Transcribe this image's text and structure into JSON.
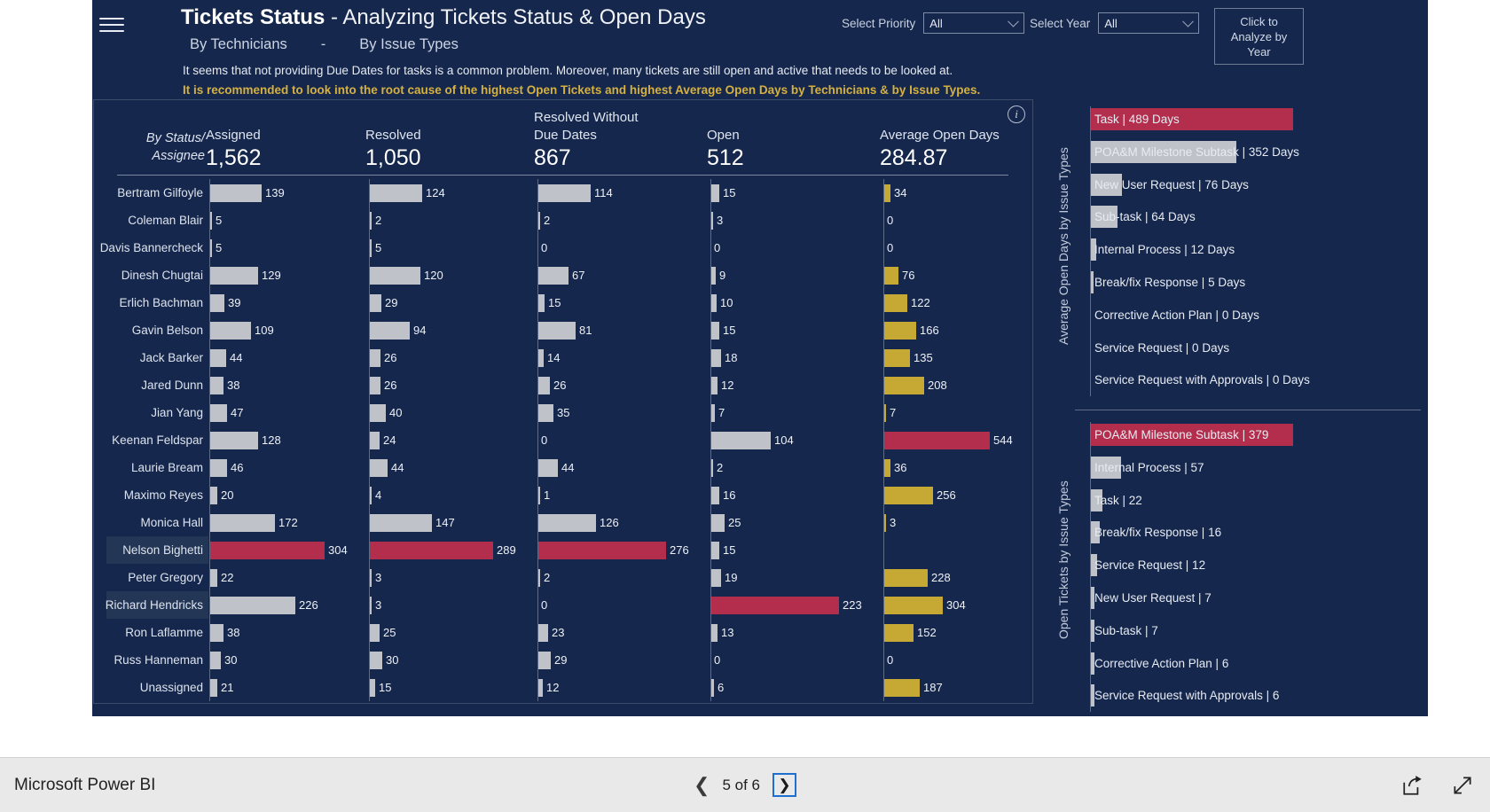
{
  "header": {
    "menu_icon": "hamburger-icon",
    "title_main": "Tickets Status",
    "title_dash": "-",
    "title_sub": "Analyzing Tickets Status & Open Days",
    "sub_left": "By Technicians",
    "sub_dash": "-",
    "sub_right": "By Issue Types",
    "narrative_line1": "It seems that not providing Due Dates for tasks is a common problem. Moreover, many tickets are still open and active that needs to be looked at.",
    "narrative_line2": "It is recommended to look into the root cause of the highest Open Tickets and highest Average Open Days by Technicians & by Issue Types.",
    "narrative_accent_color": "#d6b13f"
  },
  "slicers": [
    {
      "label": "Select Priority",
      "value": "All",
      "name": "priority-slicer"
    },
    {
      "label": "Select Year",
      "value": "All",
      "name": "year-slicer"
    }
  ],
  "analyze_button": {
    "line1": "Click to",
    "line2": "Analyze by",
    "line3": "Year"
  },
  "card": {
    "info_icon": "info-icon",
    "row_header_label_line1": "By Status/",
    "row_header_label_line2": "Assignee"
  },
  "chart_data": {
    "type": "table",
    "title": "Tickets Status by Technicians",
    "row_header": "By Status/Assignee",
    "columns": [
      {
        "label": "Assigned",
        "total": "1,562",
        "max": 304,
        "color": "#bfc3c9"
      },
      {
        "label": "Resolved",
        "total": "1,050",
        "max": 289,
        "color": "#bfc3c9"
      },
      {
        "label": "Resolved Without Due Dates",
        "total": "867",
        "max": 276,
        "color": "#bfc3c9"
      },
      {
        "label": "Open",
        "total": "512",
        "max": 223,
        "color": "#bfc3c9"
      },
      {
        "label": "Average Open Days",
        "total": "284.87",
        "max": 544,
        "color": "#c6a935"
      }
    ],
    "highlight_color": "#b32e4d",
    "selected_rows": [
      "Nelson Bighetti",
      "Richard Hendricks"
    ],
    "rows": [
      {
        "name": "Bertram Gilfoyle",
        "assigned": 139,
        "resolved": 124,
        "resolved_no_due": 114,
        "open": 15,
        "avg_open_days": 34
      },
      {
        "name": "Coleman Blair",
        "assigned": 5,
        "resolved": 2,
        "resolved_no_due": 2,
        "open": 3,
        "avg_open_days": 0
      },
      {
        "name": "Davis Bannercheck",
        "assigned": 5,
        "resolved": 5,
        "resolved_no_due": 0,
        "open": 0,
        "avg_open_days": 0
      },
      {
        "name": "Dinesh Chugtai",
        "assigned": 129,
        "resolved": 120,
        "resolved_no_due": 67,
        "open": 9,
        "avg_open_days": 76
      },
      {
        "name": "Erlich Bachman",
        "assigned": 39,
        "resolved": 29,
        "resolved_no_due": 15,
        "open": 10,
        "avg_open_days": 122
      },
      {
        "name": "Gavin Belson",
        "assigned": 109,
        "resolved": 94,
        "resolved_no_due": 81,
        "open": 15,
        "avg_open_days": 166
      },
      {
        "name": "Jack Barker",
        "assigned": 44,
        "resolved": 26,
        "resolved_no_due": 14,
        "open": 18,
        "avg_open_days": 135
      },
      {
        "name": "Jared Dunn",
        "assigned": 38,
        "resolved": 26,
        "resolved_no_due": 26,
        "open": 12,
        "avg_open_days": 208
      },
      {
        "name": "Jian Yang",
        "assigned": 47,
        "resolved": 40,
        "resolved_no_due": 35,
        "open": 7,
        "avg_open_days": 7
      },
      {
        "name": "Keenan Feldspar",
        "assigned": 128,
        "resolved": 24,
        "resolved_no_due": 0,
        "open": 104,
        "avg_open_days": 544,
        "avg_open_days_highlight": true
      },
      {
        "name": "Laurie Bream",
        "assigned": 46,
        "resolved": 44,
        "resolved_no_due": 44,
        "open": 2,
        "avg_open_days": 36
      },
      {
        "name": "Maximo Reyes",
        "assigned": 20,
        "resolved": 4,
        "resolved_no_due": 1,
        "open": 16,
        "avg_open_days": 256
      },
      {
        "name": "Monica Hall",
        "assigned": 172,
        "resolved": 147,
        "resolved_no_due": 126,
        "open": 25,
        "avg_open_days": 3
      },
      {
        "name": "Nelson Bighetti",
        "assigned": 304,
        "resolved": 289,
        "resolved_no_due": 276,
        "open": 15,
        "avg_open_days": null,
        "assigned_highlight": true,
        "resolved_highlight": true,
        "resolved_no_due_highlight": true
      },
      {
        "name": "Peter Gregory",
        "assigned": 22,
        "resolved": 3,
        "resolved_no_due": 2,
        "open": 19,
        "avg_open_days": 228
      },
      {
        "name": "Richard Hendricks",
        "assigned": 226,
        "resolved": 3,
        "resolved_no_due": 0,
        "open": 223,
        "avg_open_days": 304,
        "open_highlight": true
      },
      {
        "name": "Ron Laflamme",
        "assigned": 38,
        "resolved": 25,
        "resolved_no_due": 23,
        "open": 13,
        "avg_open_days": 152
      },
      {
        "name": "Russ Hanneman",
        "assigned": 30,
        "resolved": 30,
        "resolved_no_due": 29,
        "open": 0,
        "avg_open_days": 0
      },
      {
        "name": "Unassigned",
        "assigned": 21,
        "resolved": 15,
        "resolved_no_due": 12,
        "open": 6,
        "avg_open_days": 187
      }
    ]
  },
  "right_panels": [
    {
      "axis_title": "Average Open Days by Issue Types",
      "name": "avg-open-days-by-issue-types",
      "type": "bar",
      "max": 489,
      "unit": "Days",
      "items": [
        {
          "label": "Task | 489 Days",
          "value": 489,
          "highlight": true
        },
        {
          "label": "POA&M Milestone Subtask | 352 Days",
          "value": 352,
          "highlight": false
        },
        {
          "label": "New User Request | 76 Days",
          "value": 76,
          "highlight": false
        },
        {
          "label": "Sub-task | 64 Days",
          "value": 64,
          "highlight": false
        },
        {
          "label": "Internal Process | 12 Days",
          "value": 12,
          "highlight": false
        },
        {
          "label": "Break/fix Response | 5 Days",
          "value": 5,
          "highlight": false
        },
        {
          "label": "Corrective Action Plan | 0 Days",
          "value": 0,
          "highlight": false
        },
        {
          "label": "Service Request | 0 Days",
          "value": 0,
          "highlight": false
        },
        {
          "label": "Service Request with Approvals | 0 Days",
          "value": 0,
          "highlight": false
        }
      ]
    },
    {
      "axis_title": "Open Tickets by Issue Types",
      "name": "open-tickets-by-issue-types",
      "type": "bar",
      "max": 379,
      "unit": "",
      "items": [
        {
          "label": "POA&M Milestone Subtask | 379",
          "value": 379,
          "highlight": true
        },
        {
          "label": "Internal Process | 57",
          "value": 57,
          "highlight": false
        },
        {
          "label": "Task | 22",
          "value": 22,
          "highlight": false
        },
        {
          "label": "Break/fix Response | 16",
          "value": 16,
          "highlight": false
        },
        {
          "label": "Service Request | 12",
          "value": 12,
          "highlight": false
        },
        {
          "label": "New User Request | 7",
          "value": 7,
          "highlight": false
        },
        {
          "label": "Sub-task | 7",
          "value": 7,
          "highlight": false
        },
        {
          "label": "Corrective Action Plan | 6",
          "value": 6,
          "highlight": false
        },
        {
          "label": "Service Request with Approvals | 6",
          "value": 6,
          "highlight": false
        }
      ]
    }
  ],
  "statusbar": {
    "app_name": "Microsoft Power BI",
    "prev_icon": "chevron-left-icon",
    "page_text": "5 of 6",
    "next_icon": "chevron-right-icon",
    "share_icon": "share-icon",
    "fullscreen_icon": "fullscreen-icon"
  }
}
